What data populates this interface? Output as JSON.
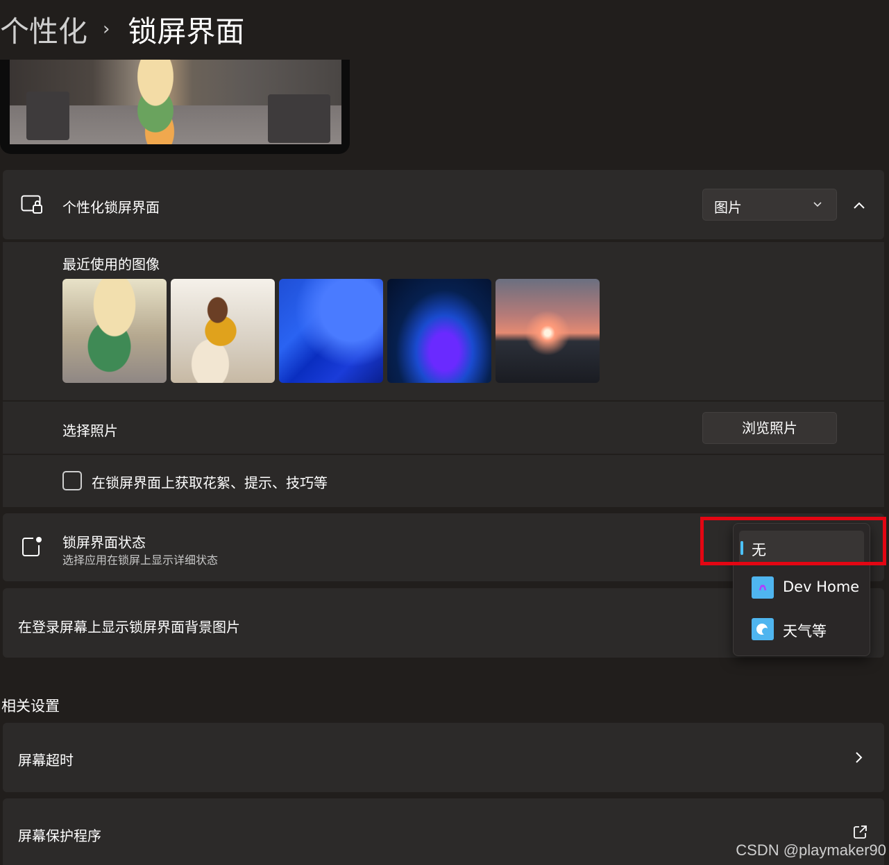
{
  "breadcrumb": {
    "parent": "个性化",
    "separator": "›",
    "current": "锁屏界面"
  },
  "personalize": {
    "title": "个性化锁屏界面",
    "dropdown_value": "图片"
  },
  "recent_images": {
    "title": "最近使用的图像"
  },
  "choose_photo": {
    "label": "选择照片",
    "button": "浏览照片"
  },
  "tips": {
    "label": "在锁屏界面上获取花絮、提示、技巧等",
    "checked": false
  },
  "status": {
    "title": "锁屏界面状态",
    "subtitle": "选择应用在锁屏上显示详细状态"
  },
  "flyout": {
    "items": [
      {
        "label": "无",
        "selected": true
      },
      {
        "label": "Dev Home",
        "icon": "dev-home-icon"
      },
      {
        "label": "天气等",
        "icon": "weather-icon"
      }
    ]
  },
  "signin_background": {
    "label": "在登录屏幕上显示锁屏界面背景图片"
  },
  "related": {
    "title": "相关设置",
    "items": [
      {
        "label": "屏幕超时",
        "icon": "chevron-right-icon"
      },
      {
        "label": "屏幕保护程序",
        "icon": "external-link-icon"
      }
    ]
  },
  "watermark": "CSDN @playmaker90",
  "colors": {
    "accent": "#4cc2ff",
    "highlight_box": "#e30613",
    "background": "#211e1c",
    "card": "#2c2a29"
  }
}
